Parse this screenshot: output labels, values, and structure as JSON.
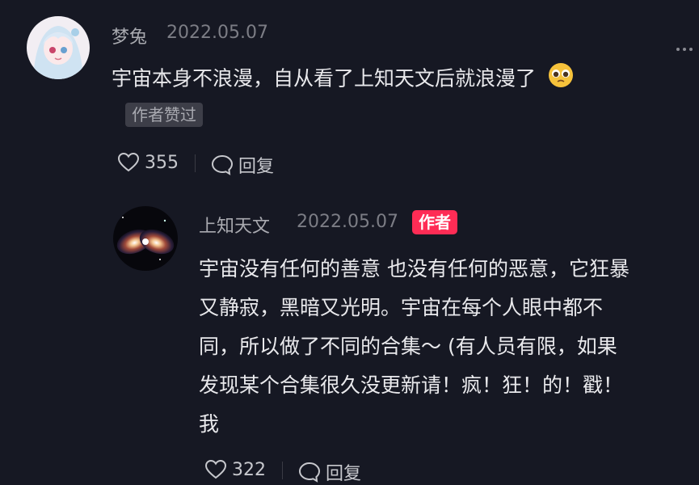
{
  "comment": {
    "username": "梦兔",
    "date": "2022.05.07",
    "text": "宇宙本身不浪漫，自从看了上知天文后就浪漫了",
    "emoji": "pleading-face-emoji",
    "author_liked_badge": "作者赞过",
    "likes": "355",
    "reply_label": "回复"
  },
  "reply": {
    "username": "上知天文",
    "date": "2022.05.07",
    "author_badge": "作者",
    "text_lines": [
      "宇宙没有任何的善意 也没有任何的恶意，它狂暴",
      "又静寂，黑暗又光明。宇宙在每个人眼中都不",
      "同，所以做了不同的合集～  (有人员有限，如果",
      "发现某个合集很久没更新请！疯！狂！的！戳！",
      "我"
    ],
    "likes": "322",
    "reply_label": "回复"
  },
  "colors": {
    "background": "#161823",
    "author_badge": "#fe2c55"
  }
}
